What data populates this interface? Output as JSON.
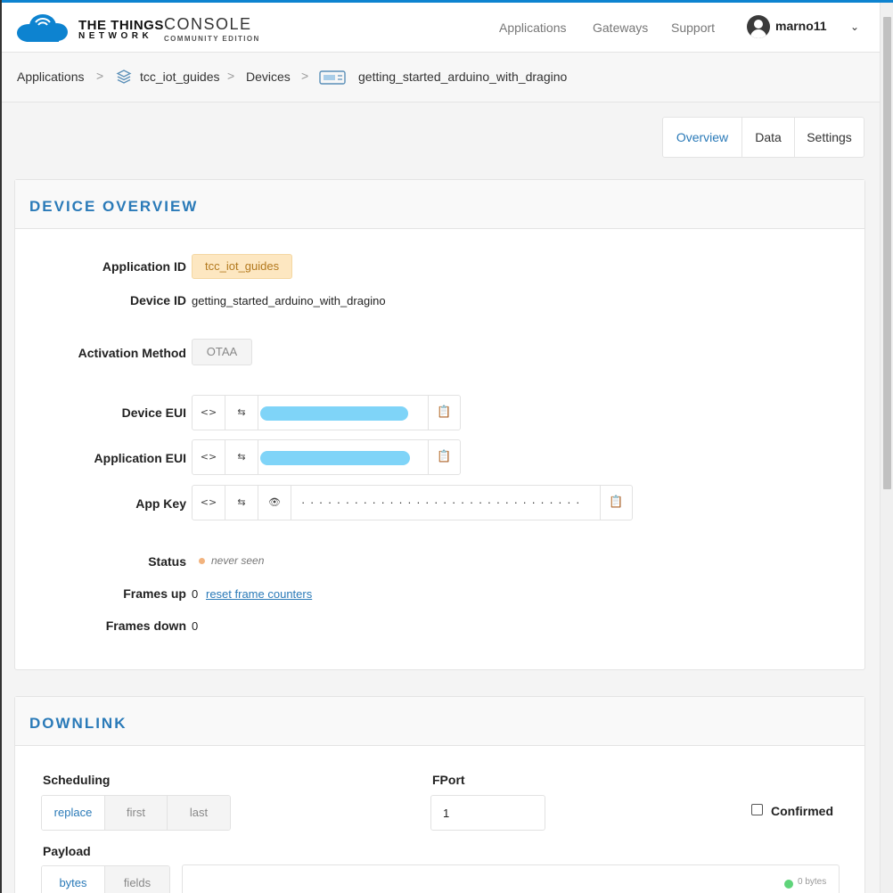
{
  "header": {
    "brand_line1": "THE THINGS",
    "brand_line2": "NETWORK",
    "console": "CONSOLE",
    "edition": "COMMUNITY EDITION",
    "nav": [
      "Applications",
      "Gateways",
      "Support"
    ],
    "username": "marno11"
  },
  "breadcrumb": {
    "items": [
      "Applications",
      "tcc_iot_guides",
      "Devices",
      "getting_started_arduino_with_dragino"
    ],
    "separator": ">"
  },
  "tabs": [
    "Overview",
    "Data",
    "Settings"
  ],
  "active_tab": "Overview",
  "overview": {
    "title": "DEVICE OVERVIEW",
    "labels": {
      "application_id": "Application ID",
      "device_id": "Device ID",
      "activation_method": "Activation Method",
      "device_eui": "Device EUI",
      "application_eui": "Application EUI",
      "app_key": "App Key",
      "status": "Status",
      "frames_up": "Frames up",
      "frames_down": "Frames down"
    },
    "application_id": "tcc_iot_guides",
    "device_id": "getting_started_arduino_with_dragino",
    "activation_method": "OTAA",
    "app_key_masked": "· · · · · · · · · · · · · · · · · · · · · · · · · · · · · · · ·",
    "status": "never seen",
    "frames_up": "0",
    "reset_frame_counters": "reset frame counters",
    "frames_down": "0",
    "icons": {
      "code": "<>",
      "swap": "⇆",
      "eye": "👁",
      "copy": "📋"
    }
  },
  "downlink": {
    "title": "DOWNLINK",
    "scheduling_label": "Scheduling",
    "scheduling_options": [
      "replace",
      "first",
      "last"
    ],
    "scheduling_selected": "replace",
    "fport_label": "FPort",
    "fport_value": "1",
    "confirmed_label": "Confirmed",
    "payload_label": "Payload",
    "payload_options": [
      "bytes",
      "fields"
    ],
    "payload_selected": "bytes",
    "byte_count": "0 bytes"
  },
  "colors": {
    "accent": "#2a7ab8",
    "top_bar": "#0d83d0",
    "app_tag_bg": "#fde7c1",
    "status_dot": "#f2b37e"
  }
}
